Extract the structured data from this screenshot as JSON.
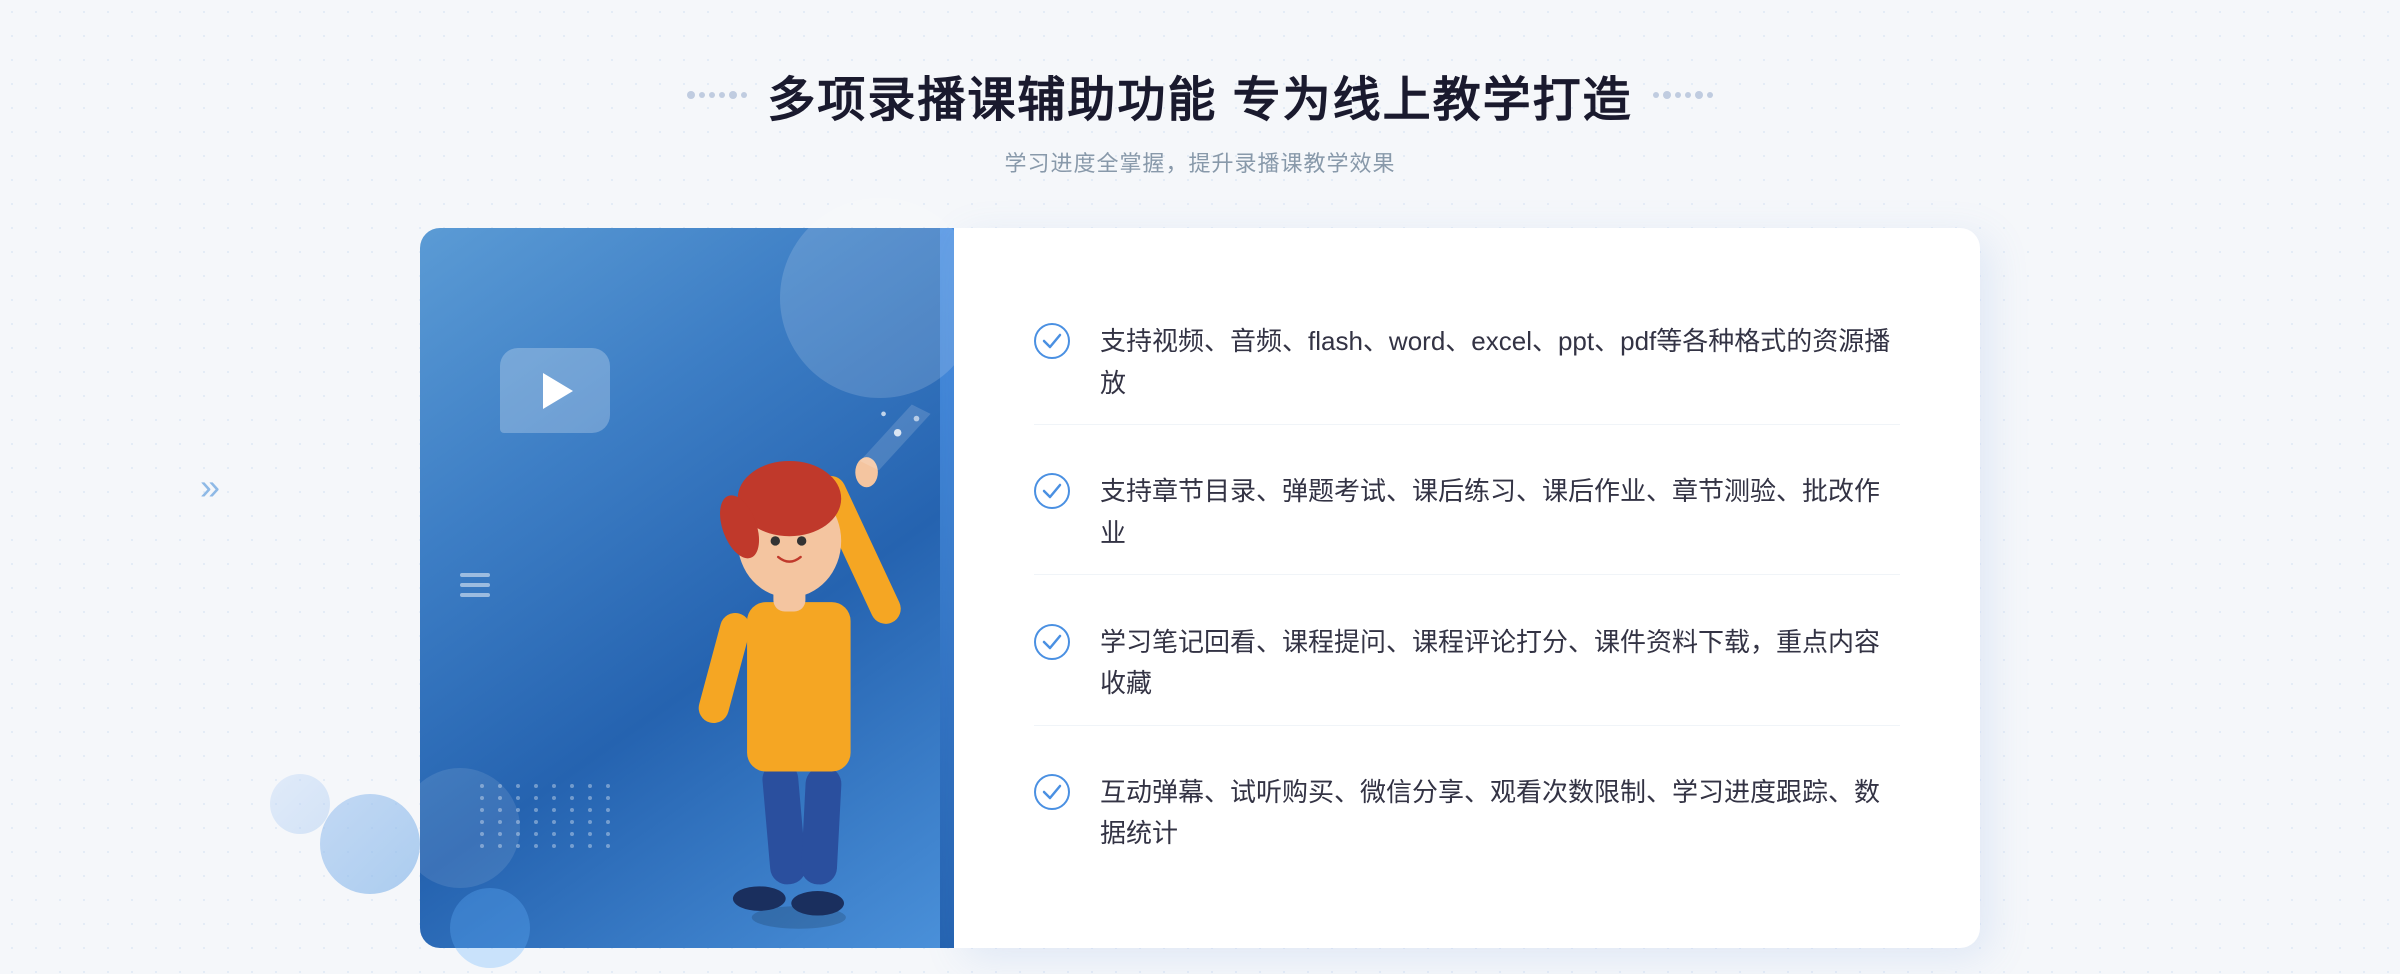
{
  "header": {
    "title": "多项录播课辅助功能 专为线上教学打造",
    "subtitle": "学习进度全掌握，提升录播课教学效果",
    "dots_left": true,
    "dots_right": true
  },
  "features": [
    {
      "id": "feature-1",
      "text": "支持视频、音频、flash、word、excel、ppt、pdf等各种格式的资源播放"
    },
    {
      "id": "feature-2",
      "text": "支持章节目录、弹题考试、课后练习、课后作业、章节测验、批改作业"
    },
    {
      "id": "feature-3",
      "text": "学习笔记回看、课程提问、课程评论打分、课件资料下载，重点内容收藏"
    },
    {
      "id": "feature-4",
      "text": "互动弹幕、试听购买、微信分享、观看次数限制、学习进度跟踪、数据统计"
    }
  ],
  "colors": {
    "accent_blue": "#3d7ec5",
    "title_color": "#1a1a2e",
    "text_color": "#333344",
    "subtitle_color": "#8899aa",
    "check_color": "#4a90e2"
  },
  "arrow_left": "»"
}
